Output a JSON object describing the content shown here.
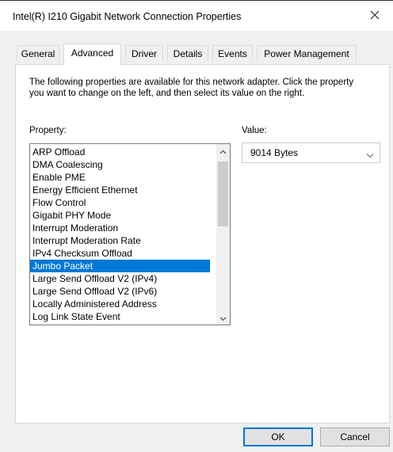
{
  "window": {
    "title": "Intel(R) I210 Gigabit Network Connection Properties",
    "close_icon": "close-icon"
  },
  "tabs": [
    {
      "label": "General",
      "active": false
    },
    {
      "label": "Advanced",
      "active": true
    },
    {
      "label": "Driver",
      "active": false
    },
    {
      "label": "Details",
      "active": false
    },
    {
      "label": "Events",
      "active": false
    },
    {
      "label": "Power Management",
      "active": false
    }
  ],
  "panel": {
    "description": "The following properties are available for this network adapter. Click the property you want to change on the left, and then select its value on the right.",
    "property_label": "Property:",
    "value_label": "Value:"
  },
  "properties": {
    "items": [
      "ARP Offload",
      "DMA Coalescing",
      "Enable PME",
      "Energy Efficient Ethernet",
      "Flow Control",
      "Gigabit PHY Mode",
      "Interrupt Moderation",
      "Interrupt Moderation Rate",
      "IPv4 Checksum Offload",
      "Jumbo Packet",
      "Large Send Offload V2 (IPv4)",
      "Large Send Offload V2 (IPv6)",
      "Locally Administered Address",
      "Log Link State Event"
    ],
    "selected": "Jumbo Packet"
  },
  "value": {
    "selected": "9014 Bytes"
  },
  "buttons": {
    "ok": "OK",
    "cancel": "Cancel"
  },
  "colors": {
    "selection": "#0078d7",
    "default_button_border": "#0078d7",
    "panel_background": "#ffffff",
    "window_background": "#f0f0f0"
  }
}
